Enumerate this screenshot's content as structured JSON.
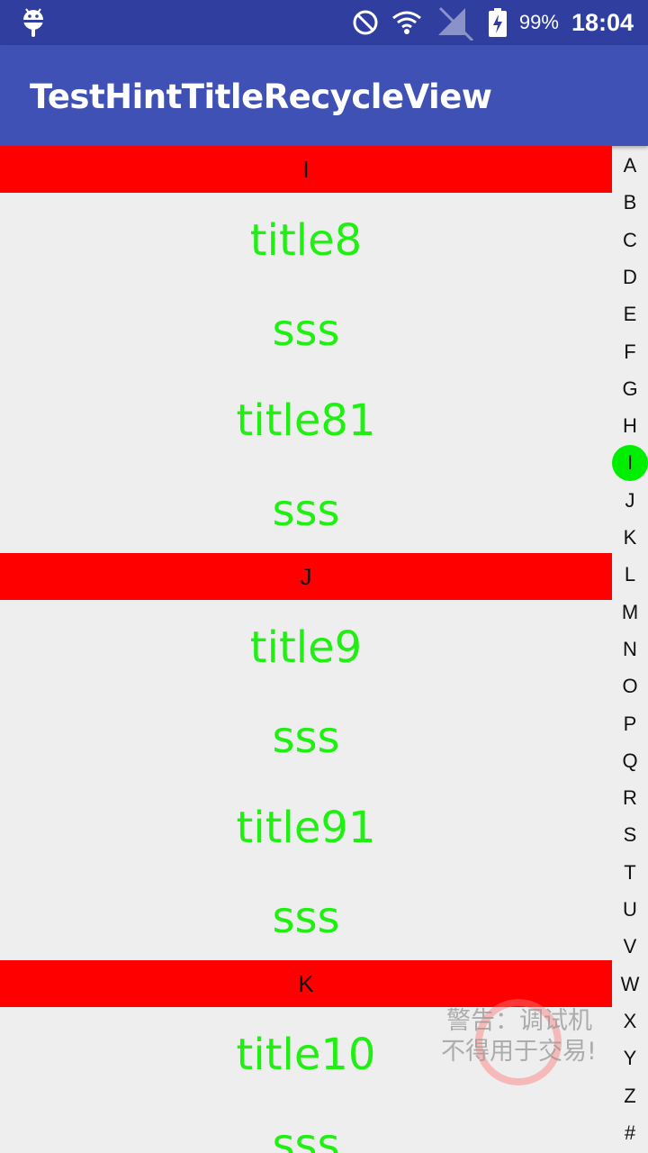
{
  "status_bar": {
    "battery_percent": "99%",
    "time": "18:04",
    "icons": [
      "android-icon",
      "do-not-disturb-icon",
      "wifi-icon",
      "no-signal-icon",
      "battery-charging-icon"
    ]
  },
  "toolbar": {
    "title": "TestHintTitleRecycleView"
  },
  "colors": {
    "status_bar": "#303f9f",
    "toolbar": "#3f51b5",
    "header": "#ff0000",
    "item_text": "#1ff012",
    "index_active": "#00ee00",
    "background": "#eeeeee"
  },
  "list": {
    "sections": [
      {
        "header": "I",
        "items": [
          "title8",
          "sss",
          "title81",
          "sss"
        ]
      },
      {
        "header": "J",
        "items": [
          "title9",
          "sss",
          "title91",
          "sss"
        ]
      },
      {
        "header": "K",
        "items": [
          "title10",
          "sss"
        ]
      }
    ]
  },
  "index_bar": {
    "letters": [
      "A",
      "B",
      "C",
      "D",
      "E",
      "F",
      "G",
      "H",
      "I",
      "J",
      "K",
      "L",
      "M",
      "N",
      "O",
      "P",
      "Q",
      "R",
      "S",
      "T",
      "U",
      "V",
      "W",
      "X",
      "Y",
      "Z",
      "#"
    ],
    "selected": "I"
  },
  "watermark": {
    "line1": "警告：调试机",
    "line2": "不得用于交易!"
  }
}
